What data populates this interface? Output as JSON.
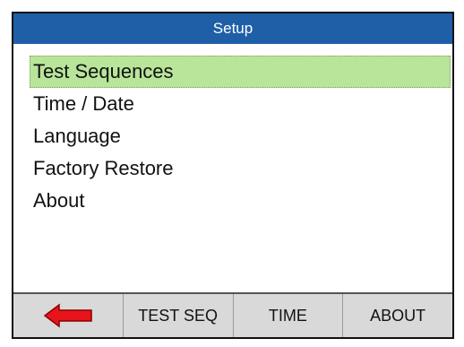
{
  "window": {
    "title": "Setup"
  },
  "menu": {
    "items": [
      {
        "label": "Test Sequences",
        "selected": true
      },
      {
        "label": "Time / Date",
        "selected": false
      },
      {
        "label": "Language",
        "selected": false
      },
      {
        "label": "Factory Restore",
        "selected": false
      },
      {
        "label": "About",
        "selected": false
      }
    ]
  },
  "softkeys": {
    "back": {
      "icon": "left-arrow-icon",
      "color": "#e8141b"
    },
    "test_seq": "TEST SEQ",
    "time": "TIME",
    "about": "ABOUT"
  },
  "colors": {
    "titlebar": "#1f5fa8",
    "selection": "#b8e59a",
    "softkey_bg": "#d9d9d9"
  }
}
